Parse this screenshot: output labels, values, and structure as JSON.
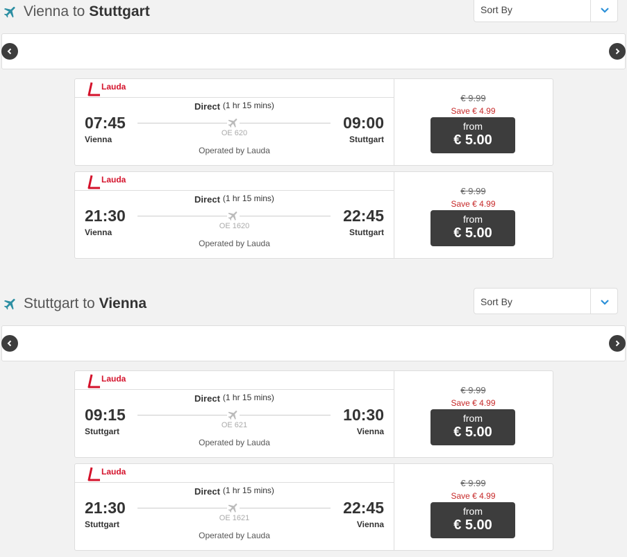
{
  "sections": [
    {
      "title_from": "Vienna to ",
      "title_to": "Stuttgart",
      "sort_label": "Sort By",
      "flights": [
        {
          "airline": "Lauda",
          "dep_time": "07:45",
          "dep_city": "Vienna",
          "arr_time": "09:00",
          "arr_city": "Stuttgart",
          "type": "Direct",
          "duration": "(1 hr 15 mins)",
          "flight_no": "OE 620",
          "operated": "Operated by Lauda",
          "old_price": "€ 9.99",
          "save": "Save € 4.99",
          "from": "from",
          "price": "€ 5.00"
        },
        {
          "airline": "Lauda",
          "dep_time": "21:30",
          "dep_city": "Vienna",
          "arr_time": "22:45",
          "arr_city": "Stuttgart",
          "type": "Direct",
          "duration": "(1 hr 15 mins)",
          "flight_no": "OE 1620",
          "operated": "Operated by Lauda",
          "old_price": "€ 9.99",
          "save": "Save € 4.99",
          "from": "from",
          "price": "€ 5.00"
        }
      ]
    },
    {
      "title_from": "Stuttgart to ",
      "title_to": "Vienna",
      "sort_label": "Sort By",
      "flights": [
        {
          "airline": "Lauda",
          "dep_time": "09:15",
          "dep_city": "Stuttgart",
          "arr_time": "10:30",
          "arr_city": "Vienna",
          "type": "Direct",
          "duration": "(1 hr 15 mins)",
          "flight_no": "OE 621",
          "operated": "Operated by Lauda",
          "old_price": "€ 9.99",
          "save": "Save € 4.99",
          "from": "from",
          "price": "€ 5.00"
        },
        {
          "airline": "Lauda",
          "dep_time": "21:30",
          "dep_city": "Stuttgart",
          "arr_time": "22:45",
          "arr_city": "Vienna",
          "type": "Direct",
          "duration": "(1 hr 15 mins)",
          "flight_no": "OE 1621",
          "operated": "Operated by Lauda",
          "old_price": "€ 9.99",
          "save": "Save € 4.99",
          "from": "from",
          "price": "€ 5.00"
        }
      ]
    }
  ],
  "icons": {
    "section": "plane-icon",
    "prev": "chevron-left-icon",
    "next": "chevron-right-icon",
    "sort": "chevron-down-icon",
    "logo": "lauda-logo"
  },
  "colors": {
    "accent": "#2d8fa3",
    "sale": "#c62828",
    "button": "#3d3d3d",
    "brand": "#d4122b"
  }
}
